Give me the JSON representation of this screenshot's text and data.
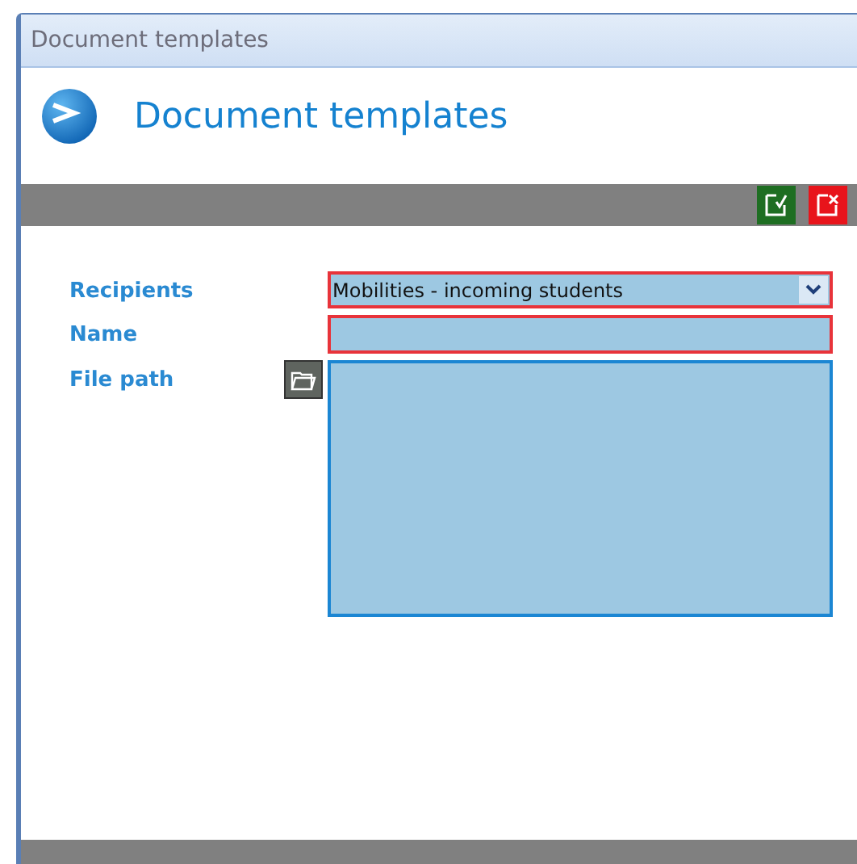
{
  "window": {
    "title": "Document templates"
  },
  "header": {
    "title": "Document templates"
  },
  "toolbar": {
    "buttons": [
      {
        "kind": "confirm"
      },
      {
        "kind": "cancel"
      }
    ]
  },
  "fields": [
    {
      "label": "Recipients",
      "kind": "dropdown",
      "value": "Mobilities - incoming students",
      "required": true
    },
    {
      "label": "Name",
      "kind": "text",
      "required": true
    },
    {
      "label": "File path",
      "kind": "file",
      "required": false
    }
  ]
}
